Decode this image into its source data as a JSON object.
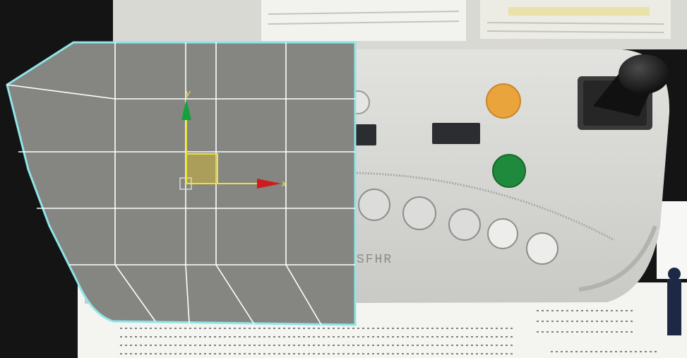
{
  "viewport": {
    "axis_x_label": "x",
    "axis_y_label": "y"
  },
  "device": {
    "engraved_text": "SFHR"
  },
  "colors": {
    "viewport_background": "#858581",
    "grid_line": "#ffffff",
    "viewport_border": "#8ee5e8",
    "axis_x": "#d01b1b",
    "axis_y": "#14a23a",
    "gizmo_center": "#c8b33a",
    "button_orange": "#eaa43c",
    "button_green": "#1f8a3c",
    "button_grey": "#d9d9d8"
  }
}
